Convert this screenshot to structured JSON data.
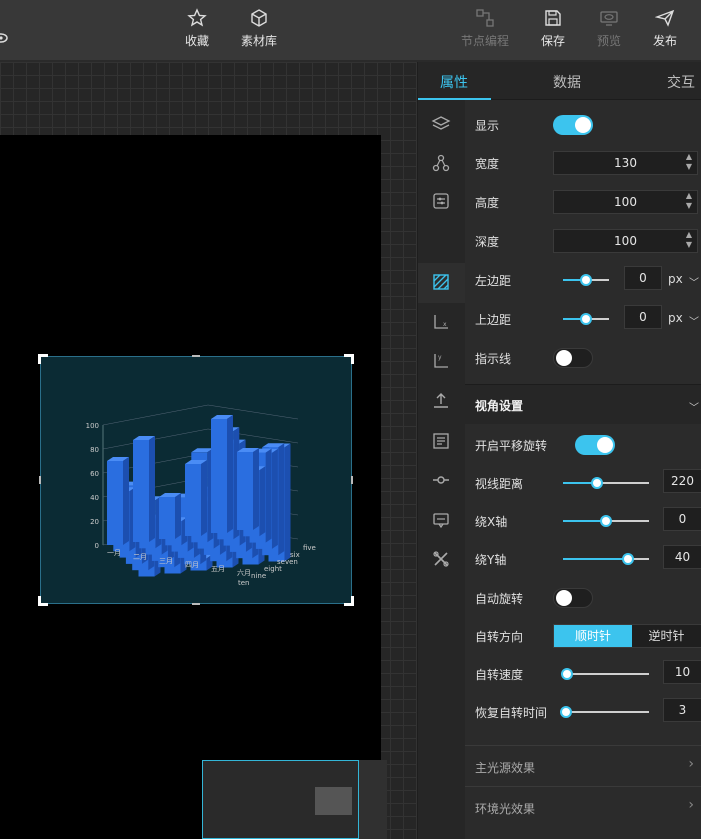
{
  "toolbar": {
    "favorites_label": "收藏",
    "assets_label": "素材库",
    "node_programming_label": "节点编程",
    "save_label": "保存",
    "preview_label": "预览",
    "publish_label": "发布"
  },
  "panel": {
    "tabs": [
      {
        "label": "属性"
      },
      {
        "label": "数据"
      },
      {
        "label": "交互"
      }
    ],
    "props": {
      "show_label": "显示",
      "width_label": "宽度",
      "width_value": "130",
      "height_label": "高度",
      "height_value": "100",
      "depth_label": "深度",
      "depth_value": "100",
      "left_margin_label": "左边距",
      "left_margin_value": "0",
      "left_margin_unit": "px",
      "top_margin_label": "上边距",
      "top_margin_value": "0",
      "top_margin_unit": "px",
      "indicator_label": "指示线"
    },
    "view": {
      "section_label": "视角设置",
      "pan_rotate_label": "开启平移旋转",
      "view_distance_label": "视线距离",
      "view_distance_value": "220",
      "rotate_x_label": "绕X轴",
      "rotate_x_value": "0",
      "rotate_y_label": "绕Y轴",
      "rotate_y_value": "40",
      "auto_rotate_label": "自动旋转",
      "rotate_dir_label": "自转方向",
      "clockwise_label": "顺时针",
      "counter_clockwise_label": "逆时针",
      "rotate_speed_label": "自转速度",
      "rotate_speed_value": "10",
      "restore_time_label": "恢复自转时间",
      "restore_time_value": "3",
      "main_light_label": "主光源效果",
      "ambient_light_label": "环境光效果"
    }
  },
  "sliders": {
    "left_margin_fraction": 0.5,
    "top_margin_fraction": 0.5,
    "view_distance_fraction": 0.4,
    "rotate_x_fraction": 0.5,
    "rotate_y_fraction": 0.75,
    "rotate_speed_fraction": 0.05,
    "restore_time_fraction": 0.03
  },
  "colors": {
    "accent": "#3cc4ee",
    "bar": "#2a6ee0",
    "chart_bg": "#0b2b34"
  },
  "chart_data": {
    "type": "bar",
    "categories": [
      "一月",
      "二月",
      "三月",
      "四月",
      "五月",
      "六月"
    ],
    "depth_categories": [
      "five",
      "six",
      "seven",
      "eight",
      "nine",
      "ten"
    ],
    "y_ticks": [
      "0",
      "20",
      "40",
      "60",
      "80",
      "100"
    ],
    "ylim": [
      0,
      100
    ],
    "series": [
      {
        "values": [
          70,
          85,
          35,
          60,
          95,
          65
        ]
      },
      {
        "values": [
          50,
          40,
          20,
          75,
          90,
          55
        ]
      },
      {
        "values": [
          60,
          30,
          45,
          40,
          85,
          75
        ]
      },
      {
        "values": [
          40,
          25,
          30,
          55,
          70,
          80
        ]
      },
      {
        "values": [
          30,
          20,
          25,
          35,
          60,
          90
        ]
      },
      {
        "values": [
          20,
          15,
          10,
          25,
          50,
          95
        ]
      }
    ]
  }
}
